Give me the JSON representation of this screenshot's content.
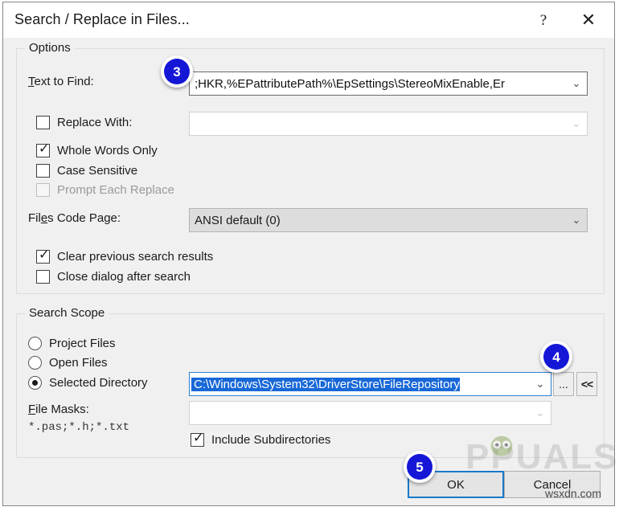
{
  "window": {
    "title": "Search / Replace in Files...",
    "help_glyph": "?",
    "close_glyph": "✕"
  },
  "options": {
    "group_title": "Options",
    "find": {
      "label_accel": "T",
      "label_rest": "ext to Find:",
      "value": ";HKR,%EPattributePath%\\EpSettings\\StereoMixEnable,Er",
      "arrow": "⌄"
    },
    "replace": {
      "label": "Replace With:",
      "value": "",
      "checked": false,
      "arrow": "⌄"
    },
    "checkboxes": [
      {
        "label": "Whole Words Only",
        "checked": true,
        "disabled": false
      },
      {
        "label": "Case Sensitive",
        "checked": false,
        "disabled": false
      },
      {
        "label": "Prompt Each Replace",
        "checked": false,
        "disabled": true
      }
    ],
    "codepage": {
      "label_pre": "Fil",
      "label_accel": "e",
      "label_rest": "s Code Page:",
      "value": "ANSI default (0)",
      "arrow": "⌄"
    },
    "result_checkboxes": [
      {
        "label": "Clear previous search results",
        "checked": true
      },
      {
        "label": "Close dialog after search",
        "checked": false
      }
    ]
  },
  "scope": {
    "group_title": "Search Scope",
    "radios": [
      {
        "label": "Project Files",
        "selected": false
      },
      {
        "label": "Open Files",
        "selected": false
      },
      {
        "label": "Selected Directory",
        "selected": true
      }
    ],
    "directory": {
      "value": "C:\\Windows\\System32\\DriverStore\\FileRepository",
      "selected": true,
      "arrow": "⌄"
    },
    "browse_label": "...",
    "collapse_label": "<<",
    "masks": {
      "label_accel": "F",
      "label_rest": "ile Masks:",
      "hint": "*.pas;*.h;*.txt",
      "value": "",
      "arrow": "⌄"
    },
    "include_subdirectories": {
      "label": "Include Subdirectories",
      "checked": true
    }
  },
  "buttons": {
    "ok": "OK",
    "cancel": "Cancel"
  },
  "badges": {
    "three": "3",
    "four": "4",
    "five": "5"
  },
  "watermark": {
    "brand": "PPUALS",
    "site": "wsxdn.com"
  },
  "colors": {
    "badge_blue": "#1517d6",
    "selection_blue": "#1868d8",
    "focus_blue": "#1878c8",
    "dialog_bg": "#f0f0f0"
  }
}
